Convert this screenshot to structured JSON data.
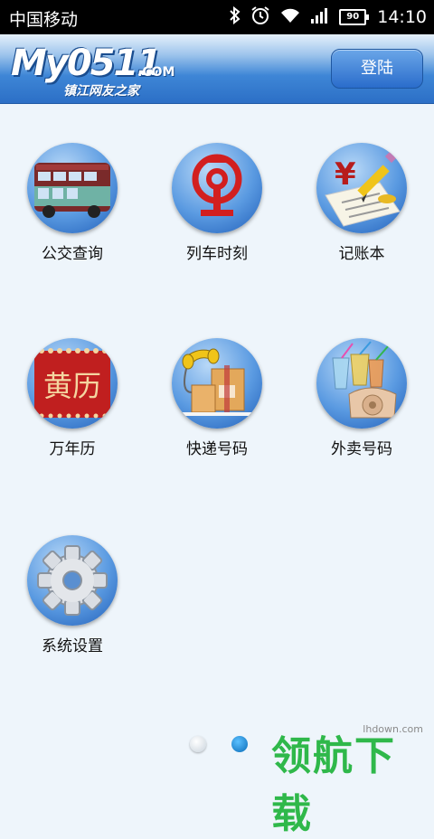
{
  "status_bar": {
    "carrier": "中国移动",
    "battery": "90",
    "time": "14:10",
    "icons": [
      "bluetooth-icon",
      "alarm-icon",
      "wifi-icon",
      "signal-icon",
      "battery-icon"
    ]
  },
  "header": {
    "logo_text": "My0511",
    "logo_com": ".COM",
    "logo_subtitle": "镇江网友之家",
    "login_label": "登陆"
  },
  "grid": {
    "items": [
      {
        "label": "公交查询",
        "icon": "bus-icon"
      },
      {
        "label": "列车时刻",
        "icon": "railway-logo-icon"
      },
      {
        "label": "记账本",
        "icon": "ledger-pen-icon"
      },
      {
        "label": "万年历",
        "icon": "calendar-icon"
      },
      {
        "label": "快递号码",
        "icon": "parcel-phone-icon"
      },
      {
        "label": "外卖号码",
        "icon": "drinks-phone-icon"
      },
      {
        "label": "系统设置",
        "icon": "gear-icon"
      }
    ],
    "calendar_glyphs": "黄历"
  },
  "pager": {
    "total": 2,
    "current": 2
  },
  "watermark": {
    "text": "领航下载",
    "url": "lhdown.com"
  },
  "colors": {
    "accent": "#2c6fc6",
    "watermark": "#2fb84a"
  }
}
